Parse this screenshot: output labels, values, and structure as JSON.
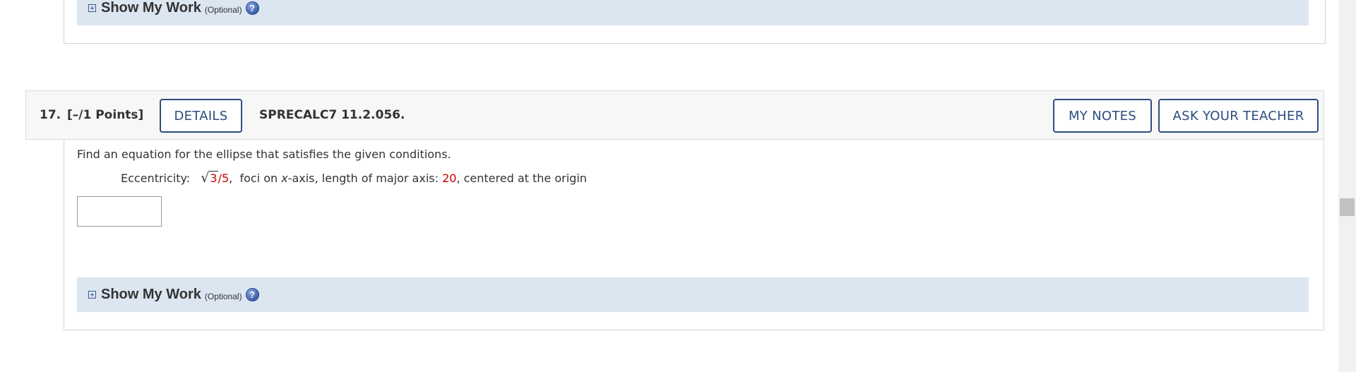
{
  "previous_question": {
    "show_my_work": {
      "label": "Show My Work",
      "optional": "(Optional)",
      "help_glyph": "?"
    }
  },
  "question": {
    "number": "17.",
    "points": "[–/1 Points]",
    "details_button": "DETAILS",
    "id": "SPRECALC7 11.2.056.",
    "my_notes_button": "MY NOTES",
    "ask_teacher_button": "ASK YOUR TEACHER",
    "prompt": "Find an equation for the ellipse that satisfies the given conditions.",
    "conditions": {
      "eccentricity_label": "Eccentricity:",
      "radicand": "3",
      "denominator": "/5",
      "comma1": ",",
      "foci_text_a": "foci on ",
      "foci_var": "x",
      "foci_text_b": "-axis, length of major axis: ",
      "major_axis_value": "20",
      "tail": ", centered at the origin"
    },
    "answer_value": "",
    "show_my_work": {
      "label": "Show My Work",
      "optional": "(Optional)",
      "help_glyph": "?"
    }
  },
  "colors": {
    "accent": "#2d4d7f",
    "highlight_red": "#cc0000",
    "show_my_work_bg": "#dce6f1"
  },
  "icons": {
    "expand": "plus-box-icon",
    "help": "help-circle-icon"
  }
}
